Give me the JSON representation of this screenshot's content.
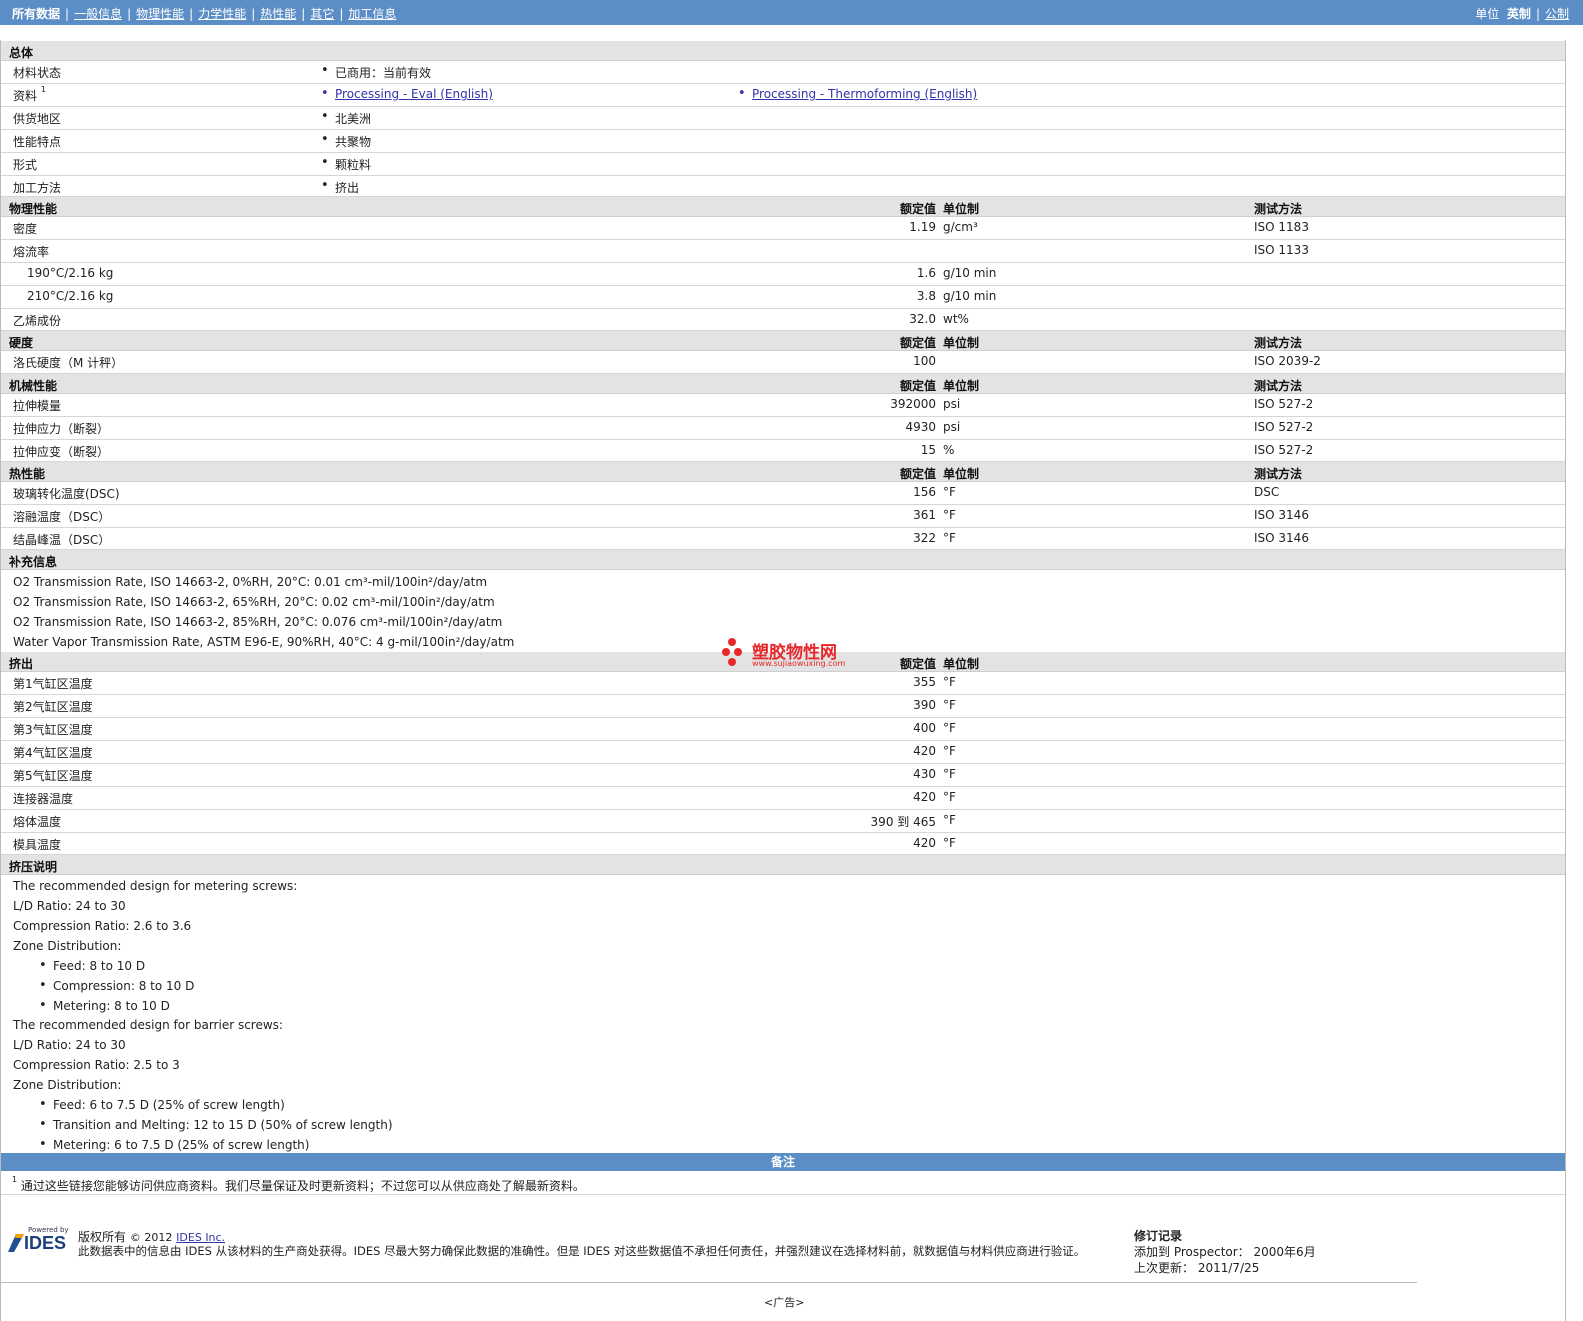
{
  "nav": {
    "items": [
      "所有数据",
      "一般信息",
      "物理性能",
      "力学性能",
      "热性能",
      "其它",
      "加工信息"
    ],
    "units_label": "单位",
    "units_english": "英制",
    "units_metric": "公制"
  },
  "general": {
    "title": "总体",
    "rows": [
      {
        "label": "材料状态",
        "value": "已商用：当前有效"
      },
      {
        "label": "资料",
        "sup": "1",
        "links": [
          "Processing - Eval (English)",
          "Processing - Thermoforming (English)"
        ]
      },
      {
        "label": "供货地区",
        "value": "北美洲"
      },
      {
        "label": "性能特点",
        "value": "共聚物"
      },
      {
        "label": "形式",
        "value": "颗粒料"
      },
      {
        "label": "加工方法",
        "value": "挤出"
      }
    ]
  },
  "col_headers": {
    "nominal": "额定值",
    "unit": "单位制",
    "method": "测试方法"
  },
  "physical": {
    "title": "物理性能",
    "rows": [
      {
        "label": "密度",
        "value": "1.19",
        "unit": "g/cm³",
        "method": "ISO 1183"
      },
      {
        "label": "熔流率",
        "value": "",
        "unit": "",
        "method": "ISO 1133"
      },
      {
        "label": "190°C/2.16 kg",
        "value": "1.6",
        "unit": "g/10 min",
        "method": ""
      },
      {
        "label": "210°C/2.16 kg",
        "value": "3.8",
        "unit": "g/10 min",
        "method": ""
      },
      {
        "label": "乙烯成份",
        "value": "32.0",
        "unit": "wt%",
        "method": ""
      }
    ]
  },
  "hardness": {
    "title": "硬度",
    "rows": [
      {
        "label": "洛氏硬度（M 计秤）",
        "value": "100",
        "unit": "",
        "method": "ISO 2039-2"
      }
    ]
  },
  "mechanical": {
    "title": "机械性能",
    "rows": [
      {
        "label": "拉伸模量",
        "value": "392000",
        "unit": "psi",
        "method": "ISO 527-2"
      },
      {
        "label": "拉伸应力（断裂）",
        "value": "4930",
        "unit": "psi",
        "method": "ISO 527-2"
      },
      {
        "label": "拉伸应变（断裂）",
        "value": "15",
        "unit": "%",
        "method": "ISO 527-2"
      }
    ]
  },
  "thermal": {
    "title": "热性能",
    "rows": [
      {
        "label": "玻璃转化温度(DSC)",
        "value": "156",
        "unit": "°F",
        "method": "DSC"
      },
      {
        "label": "溶融温度（DSC）",
        "value": "361",
        "unit": "°F",
        "method": "ISO 3146"
      },
      {
        "label": "结晶峰温（DSC）",
        "value": "322",
        "unit": "°F",
        "method": "ISO 3146"
      }
    ]
  },
  "supplement": {
    "title": "补充信息",
    "lines": [
      "O2 Transmission Rate, ISO 14663-2, 0%RH, 20°C: 0.01 cm³-mil/100in²/day/atm",
      "O2 Transmission Rate, ISO 14663-2, 65%RH, 20°C: 0.02 cm³-mil/100in²/day/atm",
      "O2 Transmission Rate, ISO 14663-2, 85%RH, 20°C: 0.076 cm³-mil/100in²/day/atm",
      "Water Vapor Transmission Rate, ASTM E96-E, 90%RH, 40°C: 4 g-mil/100in²/day/atm"
    ]
  },
  "extrusion": {
    "title": "挤出",
    "rows": [
      {
        "label": "第1气缸区温度",
        "value": "355",
        "unit": "°F"
      },
      {
        "label": "第2气缸区温度",
        "value": "390",
        "unit": "°F"
      },
      {
        "label": "第3气缸区温度",
        "value": "400",
        "unit": "°F"
      },
      {
        "label": "第4气缸区温度",
        "value": "420",
        "unit": "°F"
      },
      {
        "label": "第5气缸区温度",
        "value": "430",
        "unit": "°F"
      },
      {
        "label": "连接器温度",
        "value": "420",
        "unit": "°F"
      },
      {
        "label": "熔体温度",
        "value": "390 到  465",
        "unit": "°F"
      },
      {
        "label": "模具温度",
        "value": "420",
        "unit": "°F"
      }
    ]
  },
  "extrusion_notes": {
    "title": "挤压说明",
    "lines": [
      {
        "text": "The recommended design for metering screws:",
        "bullet": false
      },
      {
        "text": "L/D Ratio: 24 to 30",
        "bullet": false
      },
      {
        "text": "Compression Ratio: 2.6 to 3.6",
        "bullet": false
      },
      {
        "text": "Zone Distribution:",
        "bullet": false
      },
      {
        "text": "Feed: 8 to 10 D",
        "bullet": true
      },
      {
        "text": "Compression: 8 to 10 D",
        "bullet": true
      },
      {
        "text": "Metering: 8 to 10 D",
        "bullet": true
      },
      {
        "text": "The recommended design for barrier screws:",
        "bullet": false
      },
      {
        "text": "L/D Ratio: 24 to 30",
        "bullet": false
      },
      {
        "text": "Compression Ratio: 2.5 to 3",
        "bullet": false
      },
      {
        "text": "Zone Distribution:",
        "bullet": false
      },
      {
        "text": "Feed: 6 to 7.5 D (25% of screw length)",
        "bullet": true
      },
      {
        "text": "Transition and Melting: 12 to 15 D (50% of screw length)",
        "bullet": true
      },
      {
        "text": "Metering: 6 to 7.5 D (25% of screw length)",
        "bullet": true
      }
    ]
  },
  "remarks": {
    "title": "备注",
    "sup": "1",
    "text": "通过这些链接您能够访问供应商资料。我们尽量保证及时更新资料；不过您可以从供应商处了解最新资料。"
  },
  "watermark": {
    "name": "塑胶物性网",
    "url": "www.sujiaowuxing.com"
  },
  "footer": {
    "logo_powered": "Powered by",
    "logo_text": "IDES",
    "copyright_label": "版权所有",
    "copyright_year": "© 2012",
    "copyright_company": "IDES Inc.",
    "disclaimer": "此数据表中的信息由 IDES 从该材料的生产商处获得。IDES 尽最大努力确保此数据的准确性。但是 IDES 对这些数据值不承担任何责任，并强烈建议在选择材料前，就数据值与材料供应商进行验证。",
    "revision_title": "修订记录",
    "added_label": "添加到 Prospector：",
    "added_value": "2000年6月",
    "updated_label": "上次更新：",
    "updated_value": "2011/7/25",
    "ad": "<广告>"
  }
}
